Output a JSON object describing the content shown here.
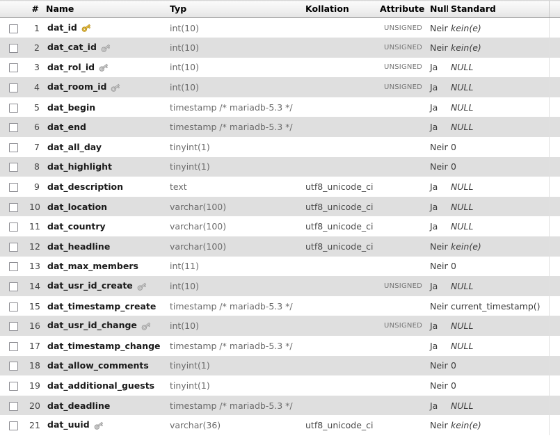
{
  "table": {
    "headers": {
      "checkbox": "",
      "number": "#",
      "name": "Name",
      "type": "Typ",
      "collation": "Kollation",
      "attribute": "Attribute",
      "null": "Null",
      "default": "Standard",
      "extra": ""
    },
    "colors": {
      "row_odd": "#ffffff",
      "row_even": "#dfdfdf",
      "header_border": "#9a9a9a",
      "name_text": "#1a1a1a",
      "type_text": "#6b6b6b",
      "attribute_text": "#757575",
      "key_primary": "#e8c14a",
      "key_index": "#b5b5b5"
    },
    "rows": [
      {
        "num": "1",
        "name": "dat_id",
        "key": "primary",
        "type": "int(10)",
        "collation": "",
        "attribute": "UNSIGNED",
        "null": "Nein",
        "default": "kein(e)",
        "default_italic": true
      },
      {
        "num": "2",
        "name": "dat_cat_id",
        "key": "index",
        "type": "int(10)",
        "collation": "",
        "attribute": "UNSIGNED",
        "null": "Nein",
        "default": "kein(e)",
        "default_italic": true
      },
      {
        "num": "3",
        "name": "dat_rol_id",
        "key": "index",
        "type": "int(10)",
        "collation": "",
        "attribute": "UNSIGNED",
        "null": "Ja",
        "default": "NULL",
        "default_italic": true
      },
      {
        "num": "4",
        "name": "dat_room_id",
        "key": "index",
        "type": "int(10)",
        "collation": "",
        "attribute": "UNSIGNED",
        "null": "Ja",
        "default": "NULL",
        "default_italic": true
      },
      {
        "num": "5",
        "name": "dat_begin",
        "key": "",
        "type": "timestamp /* mariadb-5.3 */",
        "collation": "",
        "attribute": "",
        "null": "Ja",
        "default": "NULL",
        "default_italic": true
      },
      {
        "num": "6",
        "name": "dat_end",
        "key": "",
        "type": "timestamp /* mariadb-5.3 */",
        "collation": "",
        "attribute": "",
        "null": "Ja",
        "default": "NULL",
        "default_italic": true
      },
      {
        "num": "7",
        "name": "dat_all_day",
        "key": "",
        "type": "tinyint(1)",
        "collation": "",
        "attribute": "",
        "null": "Nein",
        "default": "0",
        "default_italic": false
      },
      {
        "num": "8",
        "name": "dat_highlight",
        "key": "",
        "type": "tinyint(1)",
        "collation": "",
        "attribute": "",
        "null": "Nein",
        "default": "0",
        "default_italic": false
      },
      {
        "num": "9",
        "name": "dat_description",
        "key": "",
        "type": "text",
        "collation": "utf8_unicode_ci",
        "attribute": "",
        "null": "Ja",
        "default": "NULL",
        "default_italic": true
      },
      {
        "num": "10",
        "name": "dat_location",
        "key": "",
        "type": "varchar(100)",
        "collation": "utf8_unicode_ci",
        "attribute": "",
        "null": "Ja",
        "default": "NULL",
        "default_italic": true
      },
      {
        "num": "11",
        "name": "dat_country",
        "key": "",
        "type": "varchar(100)",
        "collation": "utf8_unicode_ci",
        "attribute": "",
        "null": "Ja",
        "default": "NULL",
        "default_italic": true
      },
      {
        "num": "12",
        "name": "dat_headline",
        "key": "",
        "type": "varchar(100)",
        "collation": "utf8_unicode_ci",
        "attribute": "",
        "null": "Nein",
        "default": "kein(e)",
        "default_italic": true
      },
      {
        "num": "13",
        "name": "dat_max_members",
        "key": "",
        "type": "int(11)",
        "collation": "",
        "attribute": "",
        "null": "Nein",
        "default": "0",
        "default_italic": false
      },
      {
        "num": "14",
        "name": "dat_usr_id_create",
        "key": "index",
        "type": "int(10)",
        "collation": "",
        "attribute": "UNSIGNED",
        "null": "Ja",
        "default": "NULL",
        "default_italic": true
      },
      {
        "num": "15",
        "name": "dat_timestamp_create",
        "key": "",
        "type": "timestamp /* mariadb-5.3 */",
        "collation": "",
        "attribute": "",
        "null": "Nein",
        "default": "current_timestamp()",
        "default_italic": false
      },
      {
        "num": "16",
        "name": "dat_usr_id_change",
        "key": "index",
        "type": "int(10)",
        "collation": "",
        "attribute": "UNSIGNED",
        "null": "Ja",
        "default": "NULL",
        "default_italic": true
      },
      {
        "num": "17",
        "name": "dat_timestamp_change",
        "key": "",
        "type": "timestamp /* mariadb-5.3 */",
        "collation": "",
        "attribute": "",
        "null": "Ja",
        "default": "NULL",
        "default_italic": true
      },
      {
        "num": "18",
        "name": "dat_allow_comments",
        "key": "",
        "type": "tinyint(1)",
        "collation": "",
        "attribute": "",
        "null": "Nein",
        "default": "0",
        "default_italic": false
      },
      {
        "num": "19",
        "name": "dat_additional_guests",
        "key": "",
        "type": "tinyint(1)",
        "collation": "",
        "attribute": "",
        "null": "Nein",
        "default": "0",
        "default_italic": false
      },
      {
        "num": "20",
        "name": "dat_deadline",
        "key": "",
        "type": "timestamp /* mariadb-5.3 */",
        "collation": "",
        "attribute": "",
        "null": "Ja",
        "default": "NULL",
        "default_italic": true
      },
      {
        "num": "21",
        "name": "dat_uuid",
        "key": "index",
        "type": "varchar(36)",
        "collation": "utf8_unicode_ci",
        "attribute": "",
        "null": "Nein",
        "default": "kein(e)",
        "default_italic": true
      }
    ]
  }
}
